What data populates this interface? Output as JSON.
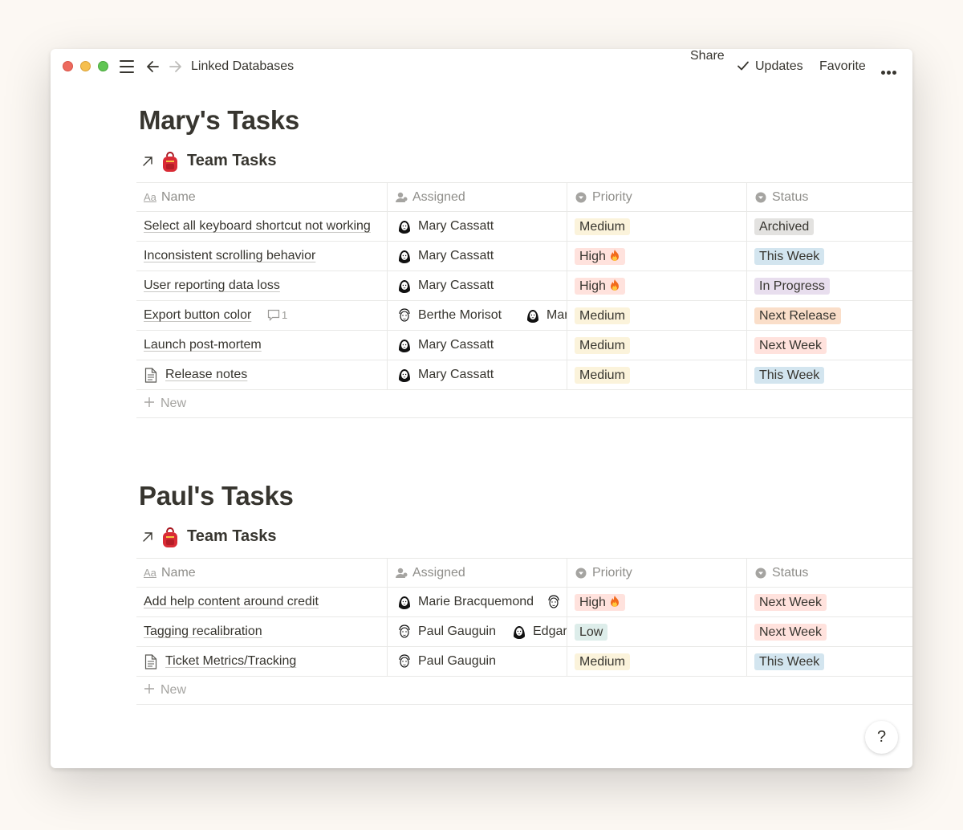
{
  "topbar": {
    "breadcrumb": "Linked Databases",
    "share": "Share",
    "updates": "Updates",
    "favorite": "Favorite"
  },
  "columns": {
    "name": "Name",
    "assigned": "Assigned",
    "priority": "Priority",
    "status": "Status",
    "name_icon": "Aa"
  },
  "tag_colors": {
    "Medium": "#fbf3db",
    "High": "#ffe2dd",
    "Low": "#ddedea",
    "Archived": "#e3e2e0",
    "This Week": "#d3e5ef",
    "In Progress": "#e8deee",
    "Next Release": "#fadec9",
    "Next Week": "#ffe2dd"
  },
  "sections": [
    {
      "title": "Mary's Tasks",
      "db_name": "Team Tasks",
      "new_label": "New",
      "rows": [
        {
          "name": "Select all keyboard shortcut not working",
          "assigned": [
            "Mary Cassatt"
          ],
          "priority": "Medium",
          "status": "Archived"
        },
        {
          "name": "Inconsistent scrolling behavior",
          "assigned": [
            "Mary Cassatt"
          ],
          "priority": "High",
          "status": "This Week"
        },
        {
          "name": "User reporting data loss",
          "assigned": [
            "Mary Cassatt"
          ],
          "priority": "High",
          "status": "In Progress"
        },
        {
          "name": "Export button color",
          "comments": "1",
          "assigned": [
            "Berthe Morisot",
            "Mary"
          ],
          "priority": "Medium",
          "status": "Next Release"
        },
        {
          "name": "Launch post-mortem",
          "assigned": [
            "Mary Cassatt"
          ],
          "priority": "Medium",
          "status": "Next Week"
        },
        {
          "name": "Release notes",
          "doc": true,
          "assigned": [
            "Mary Cassatt"
          ],
          "priority": "Medium",
          "status": "This Week"
        }
      ]
    },
    {
      "title": "Paul's Tasks",
      "db_name": "Team Tasks",
      "new_label": "New",
      "rows": [
        {
          "name": "Add help content around credit",
          "assigned": [
            "Marie Bracquemond",
            ""
          ],
          "priority": "High",
          "status": "Next Week"
        },
        {
          "name": "Tagging recalibration",
          "assigned": [
            "Paul Gauguin",
            "Edgar"
          ],
          "priority": "Low",
          "status": "Next Week"
        },
        {
          "name": "Ticket Metrics/Tracking",
          "doc": true,
          "assigned": [
            "Paul Gauguin"
          ],
          "priority": "Medium",
          "status": "This Week"
        }
      ]
    }
  ],
  "help": "?"
}
